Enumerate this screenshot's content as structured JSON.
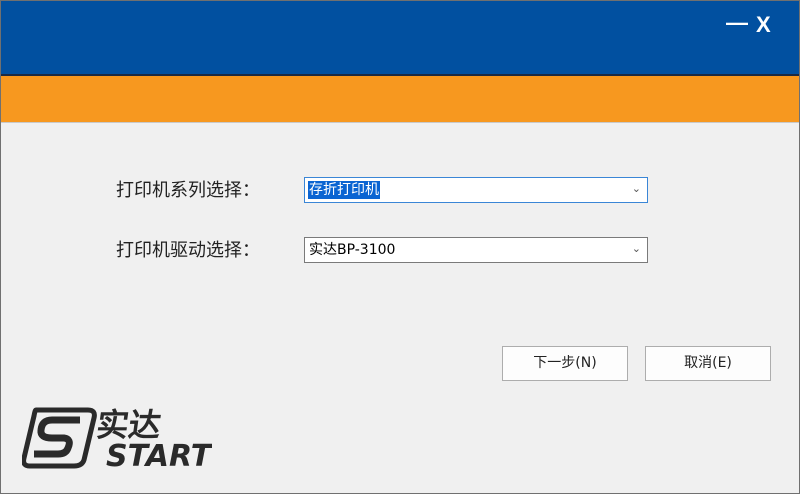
{
  "window": {
    "minimize_label": "—",
    "close_label": "X"
  },
  "colors": {
    "titlebar": "#0150a0",
    "banner": "#f7981f",
    "selection": "#0a64d2"
  },
  "form": {
    "series_label": "打印机系列选择：",
    "series_value": "存折打印机",
    "driver_label": "打印机驱动选择：",
    "driver_value": "实达BP-3100"
  },
  "buttons": {
    "next": "下一步(N)",
    "cancel": "取消(E)"
  },
  "logo": {
    "text_cn": "实达",
    "text_en": "START"
  }
}
